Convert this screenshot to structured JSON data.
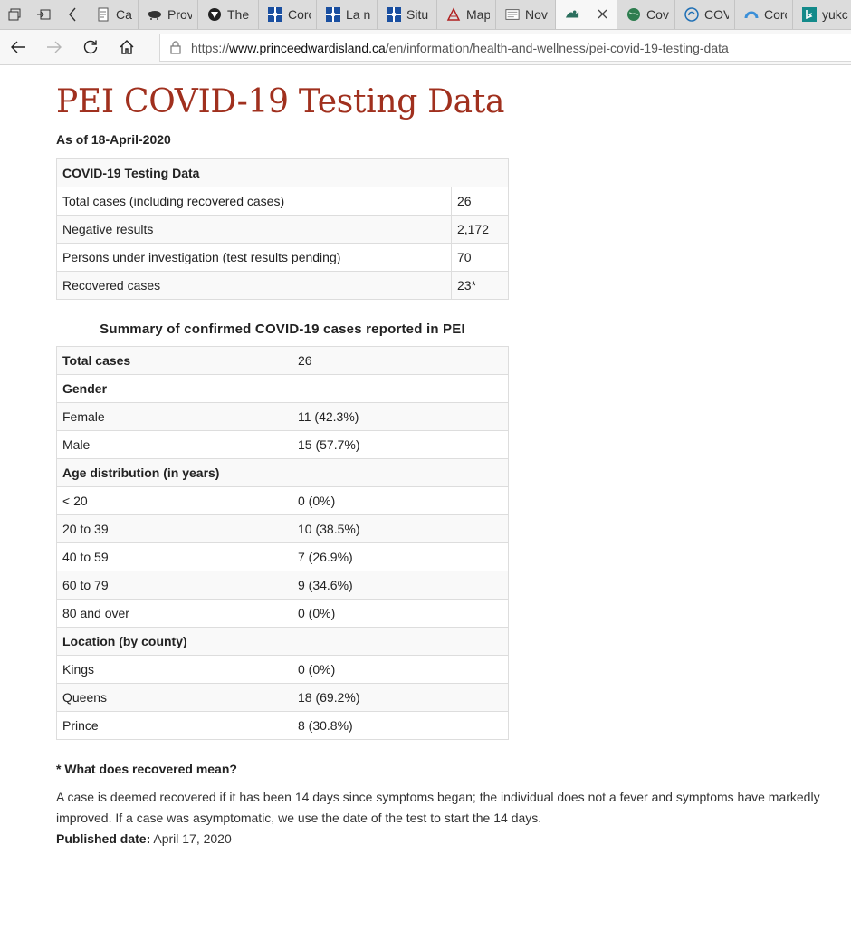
{
  "browser": {
    "tabs": [
      {
        "title": "Case",
        "icon": "document-icon"
      },
      {
        "title": "Prov",
        "icon": "bison-icon"
      },
      {
        "title": "The",
        "icon": "shield-icon"
      },
      {
        "title": "Corc",
        "icon": "quebec-flag-icon"
      },
      {
        "title": "La n",
        "icon": "quebec-flag-icon"
      },
      {
        "title": "Situ",
        "icon": "quebec-flag-icon"
      },
      {
        "title": "Map",
        "icon": "map-icon"
      },
      {
        "title": "Nov",
        "icon": "news-icon"
      },
      {
        "title": "",
        "icon": "pei-icon",
        "active": true
      },
      {
        "title": "Cov",
        "icon": "globe-icon"
      },
      {
        "title": "COV",
        "icon": "swirl-icon"
      },
      {
        "title": "Corc",
        "icon": "arc-icon"
      },
      {
        "title": "yukc",
        "icon": "bing-icon"
      }
    ],
    "url_prefix": "https://",
    "url_domain": "www.princeedwardisland.ca",
    "url_path": "/en/information/health-and-wellness/pei-covid-19-testing-data"
  },
  "page": {
    "title": "PEI COVID-19 Testing Data",
    "as_of": "As of 18-April-2020",
    "testing_table": {
      "header": "COVID-19 Testing Data",
      "rows": [
        {
          "label": "Total cases (including recovered cases)",
          "value": "26"
        },
        {
          "label": "Negative results",
          "value": "2,172"
        },
        {
          "label": "Persons under investigation (test results pending)",
          "value": "70"
        },
        {
          "label": "Recovered cases",
          "value": "23*"
        }
      ]
    },
    "summary_caption": "Summary of confirmed COVID-19 cases reported in PEI",
    "summary": {
      "total_label": "Total cases",
      "total_value": "26",
      "gender_header": "Gender",
      "gender": [
        {
          "label": "Female",
          "value": "11 (42.3%)"
        },
        {
          "label": "Male",
          "value": "15 (57.7%)"
        }
      ],
      "age_header": "Age distribution (in years)",
      "age": [
        {
          "label": "< 20",
          "value": "0 (0%)"
        },
        {
          "label": "20 to 39",
          "value": "10 (38.5%)"
        },
        {
          "label": "40 to 59",
          "value": "7 (26.9%)"
        },
        {
          "label": "60 to 79",
          "value": "9 (34.6%)"
        },
        {
          "label": "80 and over",
          "value": "0 (0%)"
        }
      ],
      "location_header": "Location (by county)",
      "location": [
        {
          "label": "Kings",
          "value": "0 (0%)"
        },
        {
          "label": "Queens",
          "value": "18 (69.2%)"
        },
        {
          "label": "Prince",
          "value": "8 (30.8%)"
        }
      ]
    },
    "recovered_question": "* What does recovered mean?",
    "recovered_text": "A case is deemed recovered if it has been 14 days since symptoms began; the individual does not a fever and symptoms have markedly improved. If a case was asymptomatic, we use the date of the test to start the 14 days.",
    "published_label": "Published date:",
    "published_value": "April 17, 2020"
  }
}
